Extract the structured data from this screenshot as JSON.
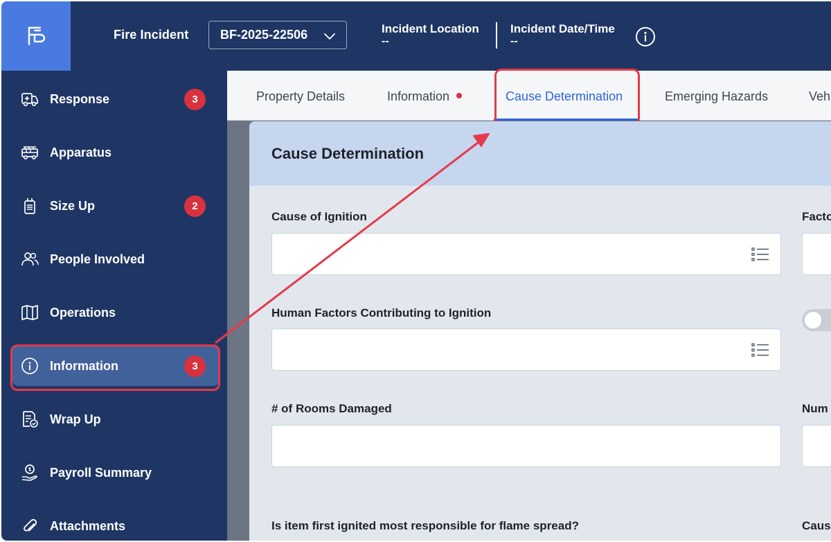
{
  "header": {
    "app_title": "Fire Incident",
    "incident_id": "BF-2025-22506",
    "location_label": "Incident Location",
    "location_value": "--",
    "datetime_label": "Incident Date/Time",
    "datetime_value": "--"
  },
  "sidebar": {
    "items": [
      {
        "label": "Response",
        "icon": "ambulance-icon",
        "badge": "3"
      },
      {
        "label": "Apparatus",
        "icon": "fire-truck-icon"
      },
      {
        "label": "Size Up",
        "icon": "radio-icon",
        "badge": "2"
      },
      {
        "label": "People Involved",
        "icon": "people-icon"
      },
      {
        "label": "Operations",
        "icon": "map-icon"
      },
      {
        "label": "Information",
        "icon": "info-icon",
        "badge": "3",
        "active": true
      },
      {
        "label": "Wrap Up",
        "icon": "document-check-icon"
      },
      {
        "label": "Payroll Summary",
        "icon": "payroll-icon"
      },
      {
        "label": "Attachments",
        "icon": "paperclip-icon"
      }
    ]
  },
  "tabs": [
    {
      "label": "Property Details"
    },
    {
      "label": "Information",
      "has_dot": true
    },
    {
      "label": "Cause Determination",
      "active": true
    },
    {
      "label": "Emerging Hazards"
    },
    {
      "label": "Veh"
    }
  ],
  "panel": {
    "title": "Cause Determination",
    "fields": {
      "cause_of_ignition": "Cause of Ignition",
      "factors_partial": "Facto",
      "human_factors": "Human Factors Contributing to Ignition",
      "rooms_damaged": "# of Rooms Damaged",
      "num_partial": "Num",
      "item_first_ignited": "Is item first ignited most responsible for flame spread?",
      "cause_partial": "Caus"
    }
  },
  "colors": {
    "header_bg": "#1f3664",
    "accent_blue": "#2f65d8",
    "badge_red": "#d8323f",
    "highlight_red": "#e43a4a"
  }
}
